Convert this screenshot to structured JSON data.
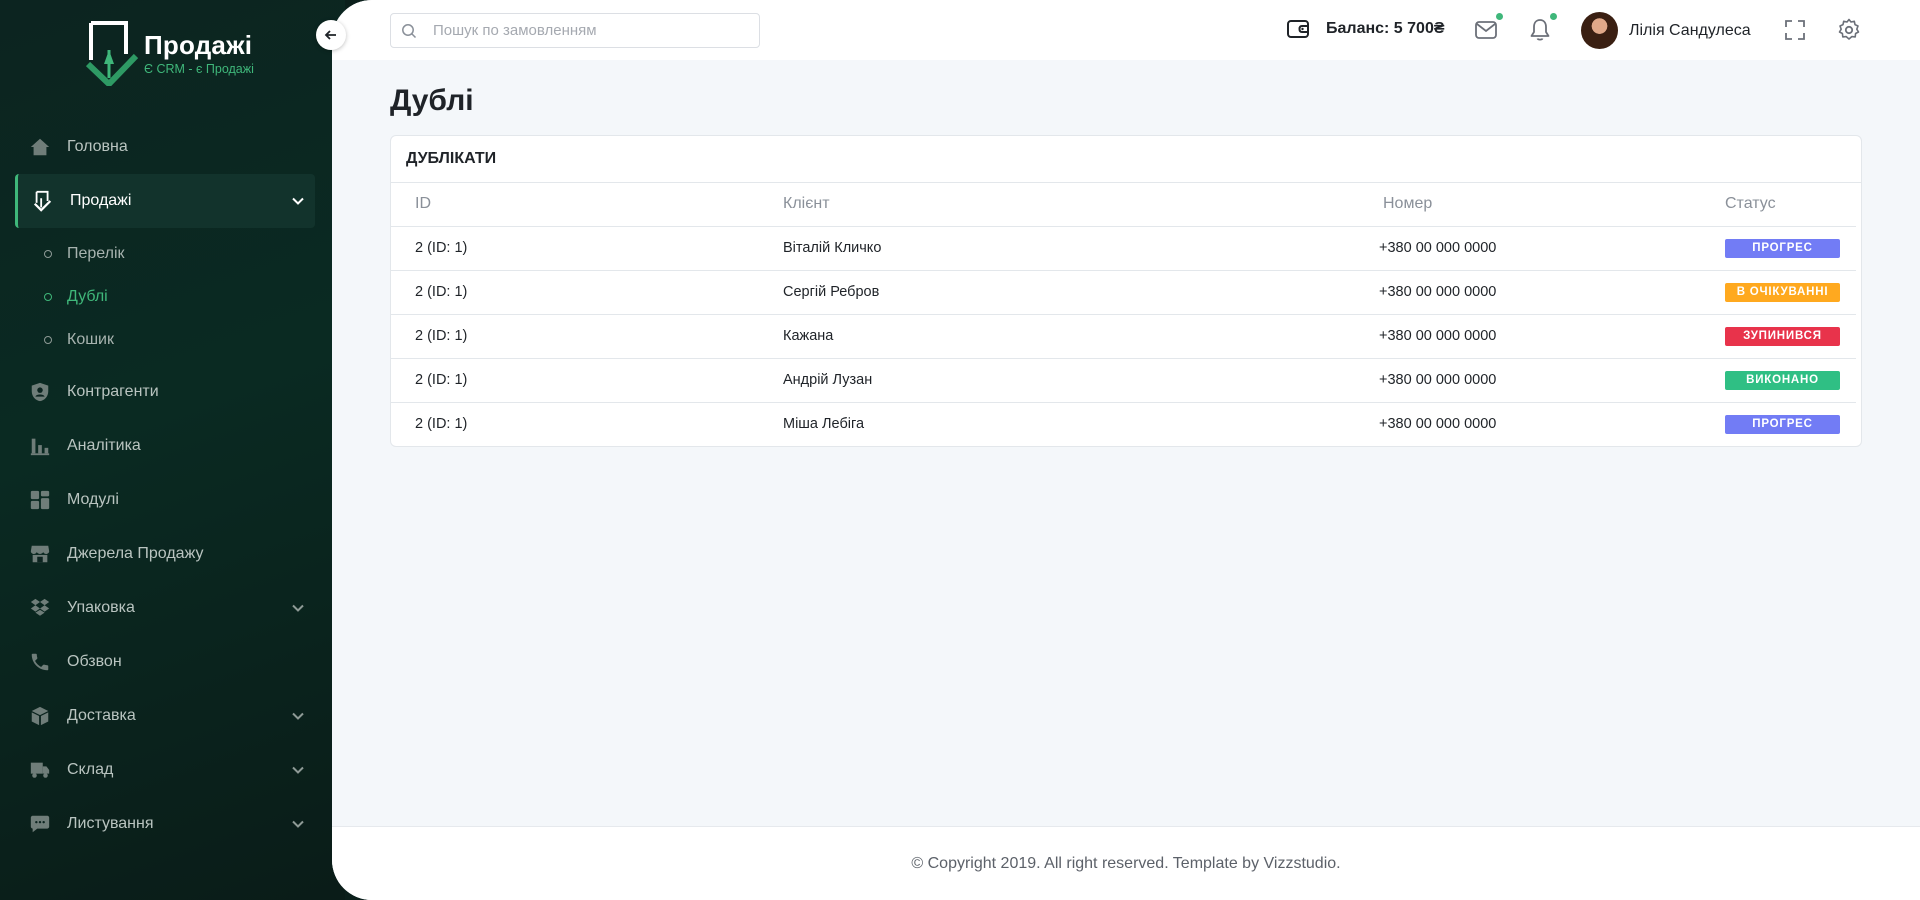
{
  "brand": {
    "title": "Продажі",
    "subtitle": "Є CRM - є Продажі"
  },
  "sidebar": {
    "items": [
      {
        "label": "Головна",
        "icon": "home-icon"
      },
      {
        "label": "Продажі",
        "icon": "sales-logo-icon",
        "active": true,
        "expanded": true,
        "children": [
          {
            "label": "Перелік"
          },
          {
            "label": "Дублі",
            "active": true
          },
          {
            "label": "Кошик"
          }
        ]
      },
      {
        "label": "Контрагенти",
        "icon": "user-shield-icon"
      },
      {
        "label": "Аналітика",
        "icon": "bar-chart-icon"
      },
      {
        "label": "Модулі",
        "icon": "grid-icon"
      },
      {
        "label": "Джерела Продажу",
        "icon": "store-icon"
      },
      {
        "label": "Упаковка",
        "icon": "dropbox-icon",
        "has_children": true
      },
      {
        "label": "Обзвон",
        "icon": "phone-icon"
      },
      {
        "label": "Доставка",
        "icon": "box-icon",
        "has_children": true
      },
      {
        "label": "Склад",
        "icon": "truck-icon",
        "has_children": true
      },
      {
        "label": "Листування",
        "icon": "chat-icon",
        "has_children": true
      }
    ]
  },
  "header": {
    "search_placeholder": "Пошук по замовленням",
    "balance": "Баланс: 5 700₴",
    "user_name": "Лілія Сандулеса"
  },
  "page": {
    "title": "Дублі"
  },
  "card": {
    "title": "ДУБЛІКАТИ",
    "columns": [
      "ID",
      "Клієнт",
      "Номер",
      "Статус"
    ],
    "rows": [
      {
        "id": "2 (ID: 1)",
        "client": "Віталій Кличко",
        "phone": "+380 00 000 0000",
        "status": "ПРОГРЕС",
        "status_color": "#727cf5"
      },
      {
        "id": "2 (ID: 1)",
        "client": "Сергій Ребров",
        "phone": "+380 00 000 0000",
        "status": "В ОЧІКУВАННІ",
        "status_color": "#ffa91f"
      },
      {
        "id": "2 (ID: 1)",
        "client": "Кажана",
        "phone": "+380 00 000 0000",
        "status": "ЗУПИНИВСЯ",
        "status_color": "#e8334b"
      },
      {
        "id": "2 (ID: 1)",
        "client": "Андрій Лузан",
        "phone": "+380 00 000 0000",
        "status": "ВИКОНАНО",
        "status_color": "#2fbf84"
      },
      {
        "id": "2 (ID: 1)",
        "client": "Міша Лебіга",
        "phone": "+380 00 000 0000",
        "status": "ПРОГРЕС",
        "status_color": "#727cf5"
      }
    ]
  },
  "footer": {
    "text": "© Copyright 2019. All right reserved. Template by Vizzstudio."
  },
  "colors": {
    "accent": "#3fb77a",
    "sidebar_bg": "#0c2420",
    "content_bg": "#f4f7fa"
  }
}
